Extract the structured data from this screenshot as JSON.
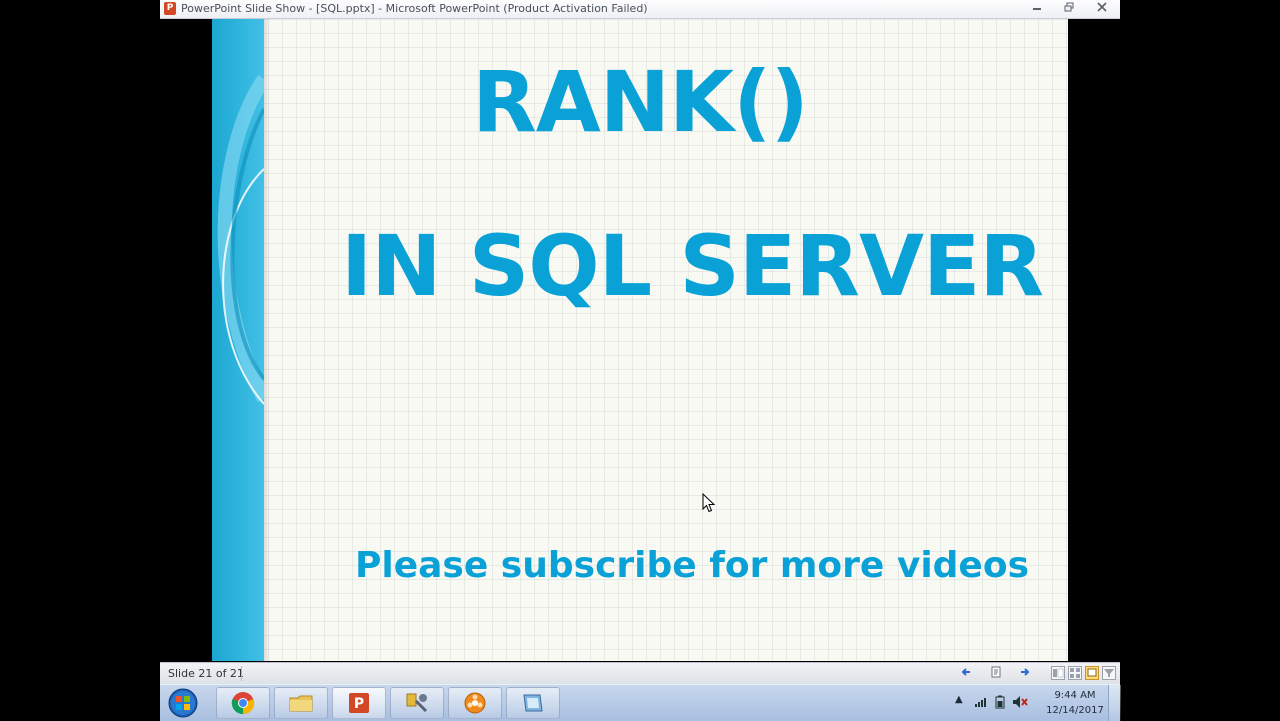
{
  "window": {
    "app_icon_letter": "P",
    "title": "PowerPoint Slide Show - [SQL.pptx] - Microsoft PowerPoint (Product Activation Failed)",
    "minimize_icon": "minimize-icon",
    "restore_icon": "restore-icon",
    "close_icon": "close-icon"
  },
  "slide": {
    "title_line1": "RANK()",
    "title_line2": "IN SQL SERVER",
    "subtitle": "Please subscribe for more videos",
    "accent_color": "#0aa2d6"
  },
  "status_bar": {
    "slide_count": "Slide 21 of 21",
    "buttons": [
      "previous-icon",
      "menu-icon",
      "next-icon",
      "normal-view-icon",
      "slide-sorter-icon",
      "reading-view-icon",
      "slide-show-icon"
    ]
  },
  "taskbar": {
    "items": [
      "start-button",
      "chrome-icon",
      "explorer-icon",
      "powerpoint-icon",
      "tools-icon",
      "media-icon",
      "app-icon"
    ],
    "clock_time": "9:44 AM",
    "clock_date": "12/14/2017"
  }
}
